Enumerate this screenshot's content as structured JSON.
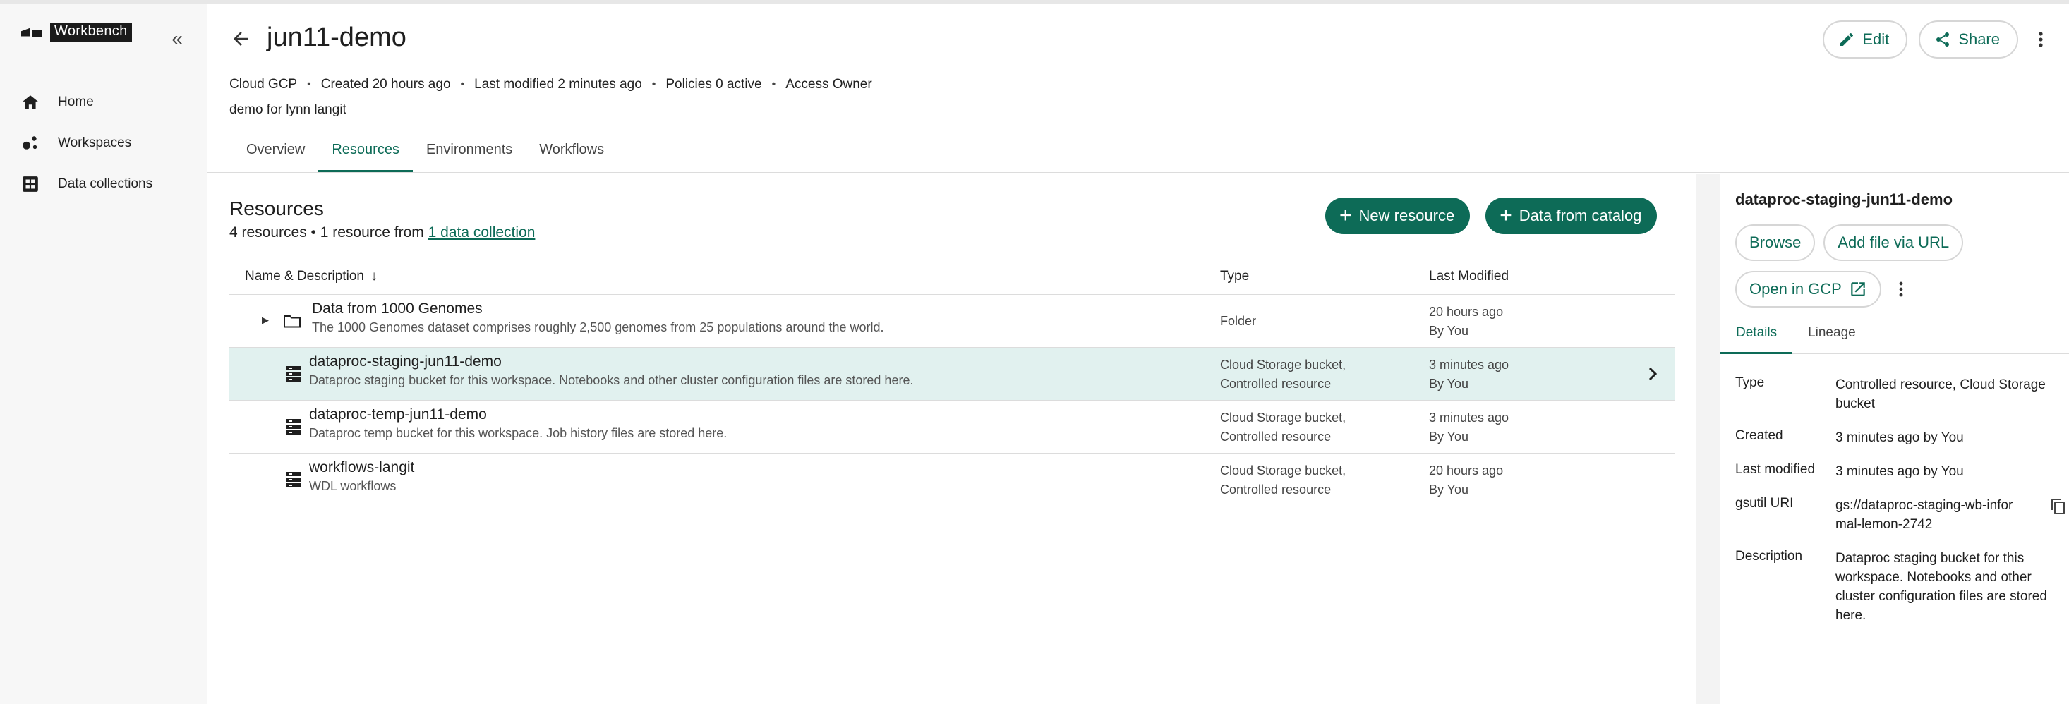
{
  "app": {
    "brand": "Workbench"
  },
  "sidebar": {
    "items": [
      {
        "label": "Home",
        "icon": "home-icon"
      },
      {
        "label": "Workspaces",
        "icon": "workspaces-icon"
      },
      {
        "label": "Data collections",
        "icon": "data-collections-icon"
      }
    ]
  },
  "header": {
    "title": "jun11-demo",
    "edit_label": "Edit",
    "share_label": "Share",
    "meta": {
      "cloud": "Cloud GCP",
      "created": "Created 20 hours ago",
      "modified": "Last modified 2 minutes ago",
      "policies": "Policies 0 active",
      "access": "Access Owner"
    },
    "description": "demo for lynn langit"
  },
  "tabs": [
    "Overview",
    "Resources",
    "Environments",
    "Workflows"
  ],
  "resources": {
    "title": "Resources",
    "summary_prefix": "4 resources • 1 resource from ",
    "summary_link": "1 data collection",
    "new_resource_label": "New resource",
    "catalog_label": "Data from catalog",
    "columns": {
      "name": "Name & Description",
      "type": "Type",
      "modified": "Last Modified"
    },
    "rows": [
      {
        "name": "Data from 1000 Genomes",
        "description": "The 1000 Genomes dataset comprises roughly 2,500 genomes from 25 populations around the world.",
        "type_line1": "Folder",
        "type_line2": "",
        "mod_line1": "20 hours ago",
        "mod_line2": "By You"
      },
      {
        "name": "dataproc-staging-jun11-demo",
        "description": "Dataproc staging bucket for this workspace. Notebooks and other cluster configuration files are stored here.",
        "type_line1": "Cloud Storage bucket,",
        "type_line2": "Controlled resource",
        "mod_line1": "3 minutes ago",
        "mod_line2": "By You"
      },
      {
        "name": "dataproc-temp-jun11-demo",
        "description": "Dataproc temp bucket for this workspace. Job history files are stored here.",
        "type_line1": "Cloud Storage bucket,",
        "type_line2": "Controlled resource",
        "mod_line1": "3 minutes ago",
        "mod_line2": "By You"
      },
      {
        "name": "workflows-langit",
        "description": "WDL workflows",
        "type_line1": "Cloud Storage bucket,",
        "type_line2": "Controlled resource",
        "mod_line1": "20 hours ago",
        "mod_line2": "By You"
      }
    ]
  },
  "panel": {
    "title": "dataproc-staging-jun11-demo",
    "browse_label": "Browse",
    "add_file_label": "Add file via URL",
    "open_gcp_label": "Open in GCP",
    "tabs": [
      "Details",
      "Lineage"
    ],
    "details": {
      "type_key": "Type",
      "type_val": "Controlled resource, Cloud Storage bucket",
      "created_key": "Created",
      "created_val": "3 minutes ago by You",
      "modified_key": "Last modified",
      "modified_val": "3 minutes ago by You",
      "uri_key": "gsutil URI",
      "uri_val": "gs://dataproc-staging-wb-informal-lemon-2742",
      "desc_key": "Description",
      "desc_val": "Dataproc staging bucket for this workspace. Notebooks and other cluster configuration files are stored here."
    }
  },
  "colors": {
    "accent": "#0d6b57",
    "selected_row": "#e1f1ef",
    "sidebar_bg": "#f7f7f7"
  }
}
